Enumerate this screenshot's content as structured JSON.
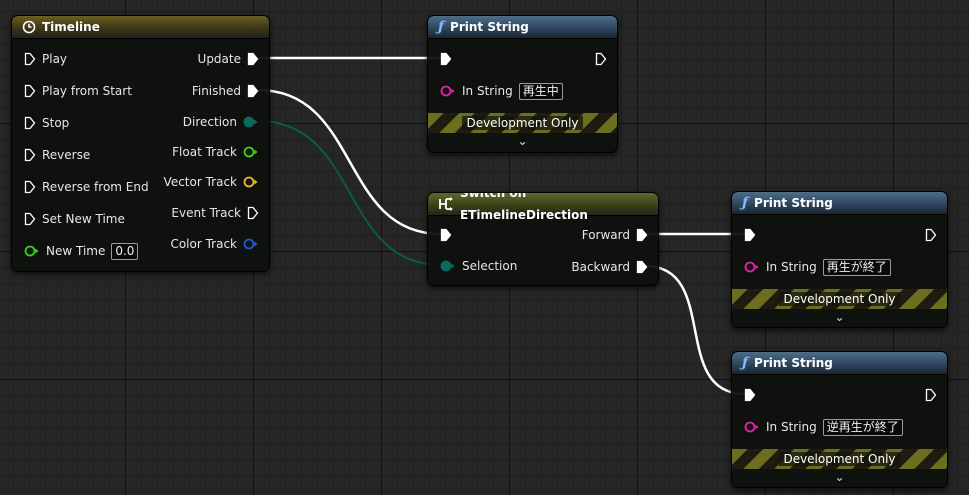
{
  "timeline": {
    "title": "Timeline",
    "inputs": [
      "Play",
      "Play from Start",
      "Stop",
      "Reverse",
      "Reverse from End",
      "Set New Time"
    ],
    "new_time_label": "New Time",
    "new_time_value": "0.0",
    "outputs": {
      "update": "Update",
      "finished": "Finished",
      "direction": "Direction",
      "float_track": "Float Track",
      "vector_track": "Vector Track",
      "event_track": "Event Track",
      "color_track": "Color Track"
    }
  },
  "print1": {
    "title": "Print String",
    "in_string_label": "In String",
    "in_string_value": "再生中",
    "dev_label": "Development Only"
  },
  "switch": {
    "title": "Switch on ETimelineDirection",
    "selection_label": "Selection",
    "forward_label": "Forward",
    "backward_label": "Backward"
  },
  "print2": {
    "title": "Print String",
    "in_string_label": "In String",
    "in_string_value": "再生が終了",
    "dev_label": "Development Only"
  },
  "print3": {
    "title": "Print String",
    "in_string_label": "In String",
    "in_string_value": "逆再生が終了",
    "dev_label": "Development Only"
  },
  "colors": {
    "exec_wire": "#ffffff",
    "enum_wire": "#0a5a4e",
    "string_pin": "#e01fb0",
    "float_pin": "#39d116",
    "vector_pin": "#f2b82a",
    "color_pin": "#1d5ad6",
    "enum_pin": "#0a6b5d",
    "timeline_header": "#6b5f22",
    "function_header": "#4f6d86",
    "switch_header": "#5d6a2a"
  }
}
